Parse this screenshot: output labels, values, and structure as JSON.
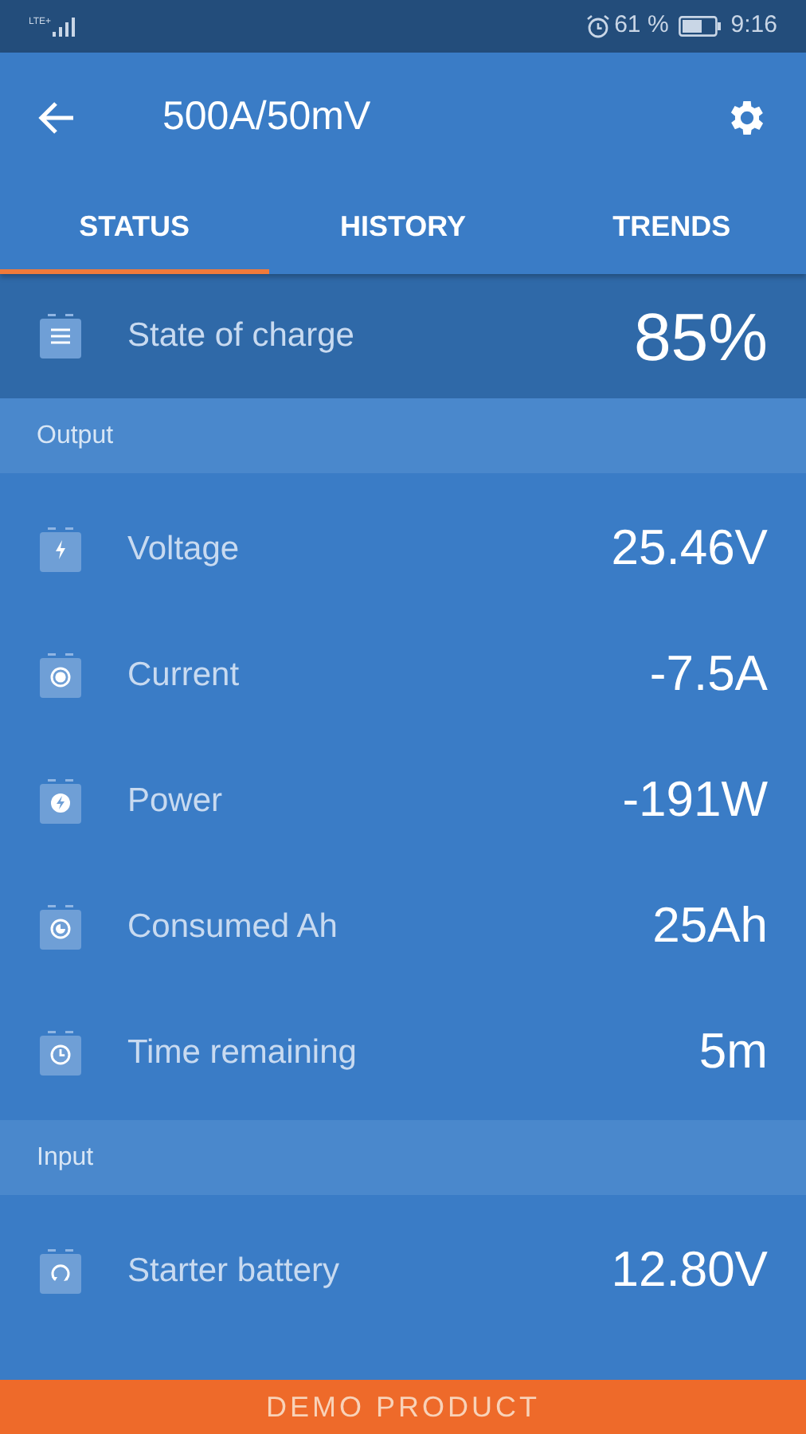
{
  "status_bar": {
    "network": "LTE+",
    "battery": "61 %",
    "time": "9:16"
  },
  "header": {
    "title": "500A/50mV"
  },
  "tabs": [
    {
      "label": "STATUS",
      "selected": true
    },
    {
      "label": "HISTORY",
      "selected": false
    },
    {
      "label": "TRENDS",
      "selected": false
    }
  ],
  "state_of_charge": {
    "kind": "lines",
    "label": "State of charge",
    "value": "85%"
  },
  "sections": [
    {
      "title": "Output",
      "rows": [
        {
          "kind": "bolt",
          "label": "Voltage",
          "value": "25.46V"
        },
        {
          "kind": "dot",
          "label": "Current",
          "value": "-7.5A"
        },
        {
          "kind": "boltcircle",
          "label": "Power",
          "value": "-191W"
        },
        {
          "kind": "pie",
          "label": "Consumed Ah",
          "value": "25Ah"
        },
        {
          "kind": "clock",
          "label": "Time remaining",
          "value": "5m"
        }
      ]
    },
    {
      "title": "Input",
      "rows": [
        {
          "kind": "loop",
          "label": "Starter battery",
          "value": "12.80V"
        }
      ]
    }
  ],
  "footer": "DEMO PRODUCT"
}
